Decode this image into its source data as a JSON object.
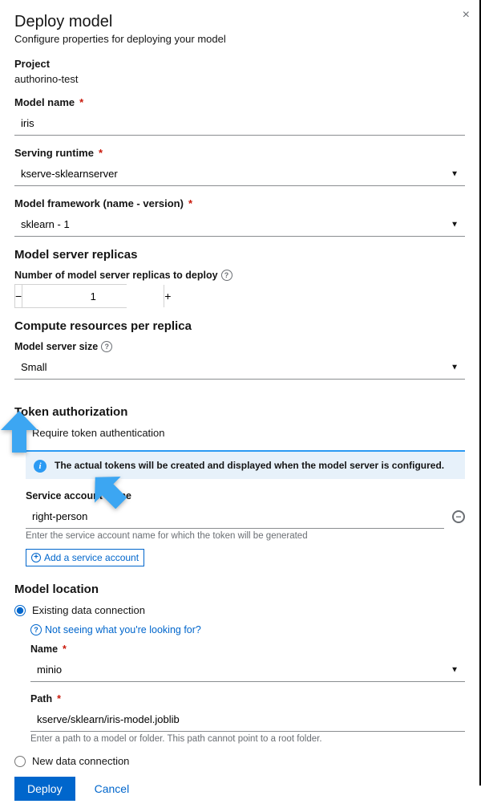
{
  "header": {
    "title": "Deploy model",
    "subtitle": "Configure properties for deploying your model",
    "close": "×"
  },
  "project": {
    "label": "Project",
    "value": "authorino-test"
  },
  "model_name": {
    "label": "Model name",
    "value": "iris"
  },
  "runtime": {
    "label": "Serving runtime",
    "value": "kserve-sklearnserver"
  },
  "framework": {
    "label": "Model framework (name - version)",
    "value": "sklearn - 1"
  },
  "replicas_section": {
    "heading": "Model server replicas",
    "label": "Number of model server replicas to deploy",
    "value": "1",
    "minus": "−",
    "plus": "+"
  },
  "compute_section": {
    "heading": "Compute resources per replica",
    "label": "Model server size",
    "value": "Small"
  },
  "token": {
    "heading": "Token authorization",
    "checkbox_label": "Require token authentication",
    "info": "The actual tokens will be created and displayed when the model server is configured.",
    "svc_label": "Service account name",
    "svc_value": "right-person",
    "svc_helper": "Enter the service account name for which the token will be generated",
    "add_label": "Add a service account",
    "remove": "−"
  },
  "location": {
    "heading": "Model location",
    "existing_label": "Existing data connection",
    "hint": "Not seeing what you're looking for?",
    "name_label": "Name",
    "name_value": "minio",
    "path_label": "Path",
    "path_value": "kserve/sklearn/iris-model.joblib",
    "path_helper": "Enter a path to a model or folder. This path cannot point to a root folder.",
    "new_label": "New data connection"
  },
  "footer": {
    "deploy": "Deploy",
    "cancel": "Cancel"
  },
  "help": "?"
}
